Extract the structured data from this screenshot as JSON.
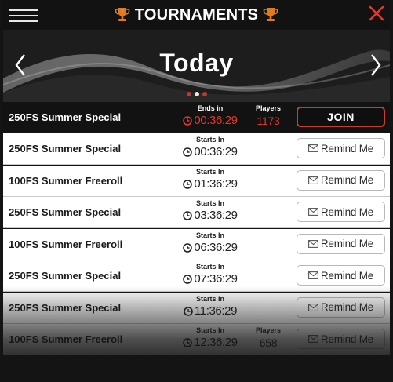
{
  "header": {
    "title": "TOURNAMENTS",
    "menu_icon": "hamburger-menu-icon",
    "trophy_icon": "trophy-icon",
    "close_icon": "close-icon",
    "accent": "#d03a2a"
  },
  "banner": {
    "day": "Today",
    "prev_icon": "chevron-left-icon",
    "next_icon": "chevron-right-icon",
    "pager_count": 3,
    "pager_active": 1
  },
  "live_row": {
    "name": "250FS Summer Special",
    "time_label": "Ends in",
    "time": "00:36:29",
    "players_label": "Players",
    "players": "1173",
    "button": "JOIN"
  },
  "rows": [
    {
      "name": "250FS Summer Special",
      "time_label": "Starts In",
      "time": "00:36:29",
      "button": "Remind Me"
    },
    {
      "name": "100FS Summer Freeroll",
      "time_label": "Starts In",
      "time": "01:36:29",
      "button": "Remind Me"
    },
    {
      "name": "250FS Summer Special",
      "time_label": "Starts In",
      "time": "03:36:29",
      "button": "Remind Me"
    },
    {
      "name": "100FS Summer Freeroll",
      "time_label": "Starts In",
      "time": "06:36:29",
      "button": "Remind Me"
    },
    {
      "name": "250FS Summer Special",
      "time_label": "Starts In",
      "time": "07:36:29",
      "button": "Remind Me"
    },
    {
      "name": "250FS Summer Special",
      "time_label": "Starts In",
      "time": "11:36:29",
      "button": "Remind Me"
    },
    {
      "name": "100FS Summer Freeroll",
      "time_label": "Starts In",
      "time": "12:36:29",
      "players_label": "Players",
      "players": "658",
      "button": "Remind Me"
    }
  ]
}
